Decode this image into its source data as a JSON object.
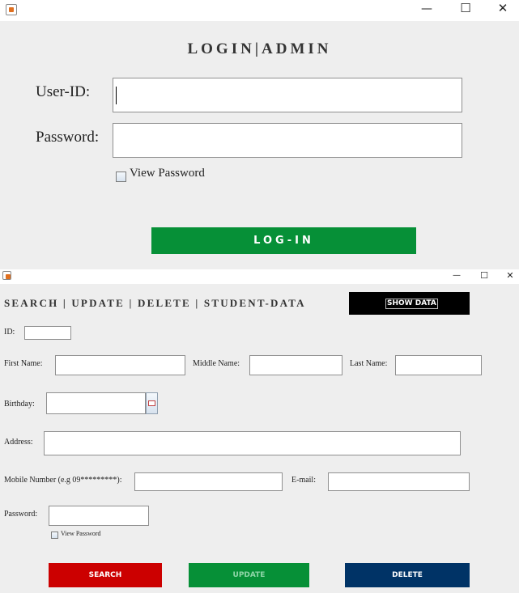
{
  "login_window": {
    "title": "LOGIN|ADMIN",
    "user_id_label": "User-ID:",
    "password_label": "Password:",
    "view_password_label": "View Password",
    "login_button": "LOG-IN"
  },
  "student_window": {
    "title": "SEARCH | UPDATE | DELETE | STUDENT-DATA",
    "show_data_button": "SHOW DATA",
    "id_label": "ID:",
    "first_name_label": "First Name:",
    "middle_name_label": "Middle Name:",
    "last_name_label": "Last Name:",
    "birthday_label": "Birthday:",
    "address_label": "Address:",
    "mobile_label": "Mobile Number (e.g 09*********):",
    "email_label": "E-mail:",
    "password_label": "Password:",
    "view_password_label": "View Password",
    "search_button": "SEARCH",
    "update_button": "UPDATE",
    "delete_button": "DELETE"
  },
  "window_controls": {
    "minimize": "—",
    "maximize": "☐",
    "close": "✕"
  },
  "icons": {
    "app": "java-icon",
    "calendar": "calendar-icon"
  },
  "colors": {
    "login_button": "#069037",
    "search_button": "#cc0000",
    "update_button": "#069037",
    "delete_button": "#003366",
    "show_data_button": "#000000"
  }
}
